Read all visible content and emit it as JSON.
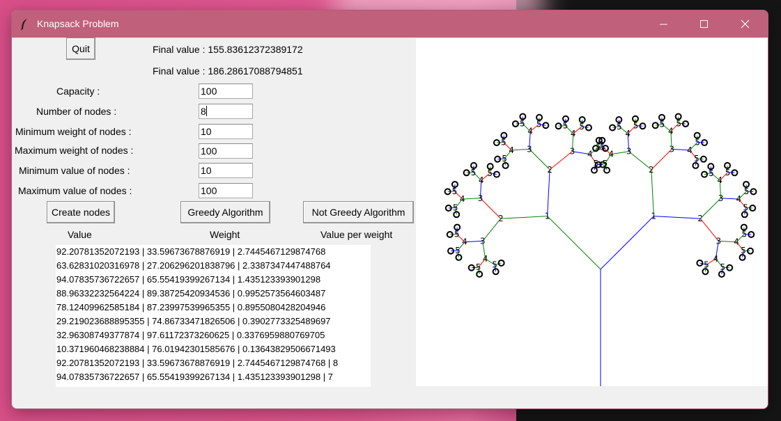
{
  "window": {
    "title": "Knapsack Problem"
  },
  "controls": {
    "quit_label": "Quit",
    "final_value_1": "Final value : 155.83612372389172",
    "final_value_2": "Final value : 186.28617088794851",
    "capacity_label": "Capacity :",
    "capacity_value": "100",
    "num_nodes_label": "Number of nodes :",
    "num_nodes_value": "8",
    "min_weight_label": "Minimum weight of nodes :",
    "min_weight_value": "10",
    "max_weight_label": "Maximum weight of nodes :",
    "max_weight_value": "100",
    "min_value_label": "Minimum value of nodes :",
    "min_value_value": "10",
    "max_value_label": "Maximum value of nodes :",
    "max_value_value": "100",
    "create_nodes_label": "Create nodes",
    "greedy_label": "Greedy Algorithm",
    "not_greedy_label": "Not Greedy Algorithm"
  },
  "list": {
    "headers": [
      "Value",
      "Weight",
      "Value per weight"
    ],
    "rows": [
      "92.20781352072193 | 33.59673678876919 | 2.7445467129874768",
      "63.62831020316978 | 27.206296201838796 | 2.3387347447488764",
      "94.07835736722657 | 65.55419399267134 | 1.435123393901298",
      "88.96332232564224 | 89.38725420934536 | 0.9952573564603487",
      "78.12409962585184 | 87.23997539965355 | 0.8955080428204946",
      "29.219023688895355 | 74.86733471826506 | 0.3902773325489697",
      "32.96308749377874 | 97.61172373260625 | 0.3376959880769705",
      "10.371960468238884 | 76.01942301585676 | 0.13643829506671493",
      "92.20781352072193 | 33.59673678876919 | 2.7445467129874768 | 8",
      "94.07835736722657 | 65.55419399267134 | 1.435123393901298 | 7"
    ]
  },
  "tree": {
    "root_color": "#0000ff",
    "left_color": "#008000",
    "right_color": "#0000ff",
    "reject_color": "#ff0000",
    "level_labels": [
      "1",
      "2",
      "3",
      "4",
      "5"
    ]
  }
}
